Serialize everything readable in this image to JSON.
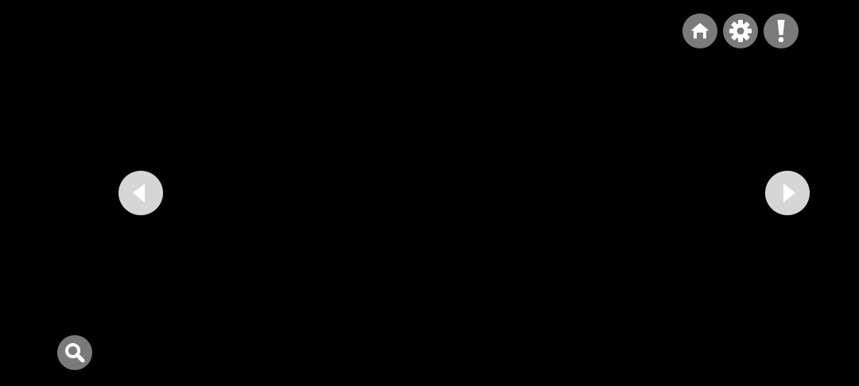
{
  "colors": {
    "background": "#000000",
    "toolbar_button": "#7a7a7a",
    "nav_button": "#d6d6d6",
    "glyph_light": "#ffffff"
  },
  "toolbar": {
    "icons": [
      "home-icon",
      "gear-icon",
      "exclamation-icon"
    ]
  },
  "navigation": {
    "icons": [
      "chevron-left-icon",
      "chevron-right-icon"
    ]
  },
  "search": {
    "icon": "magnifier-icon"
  }
}
